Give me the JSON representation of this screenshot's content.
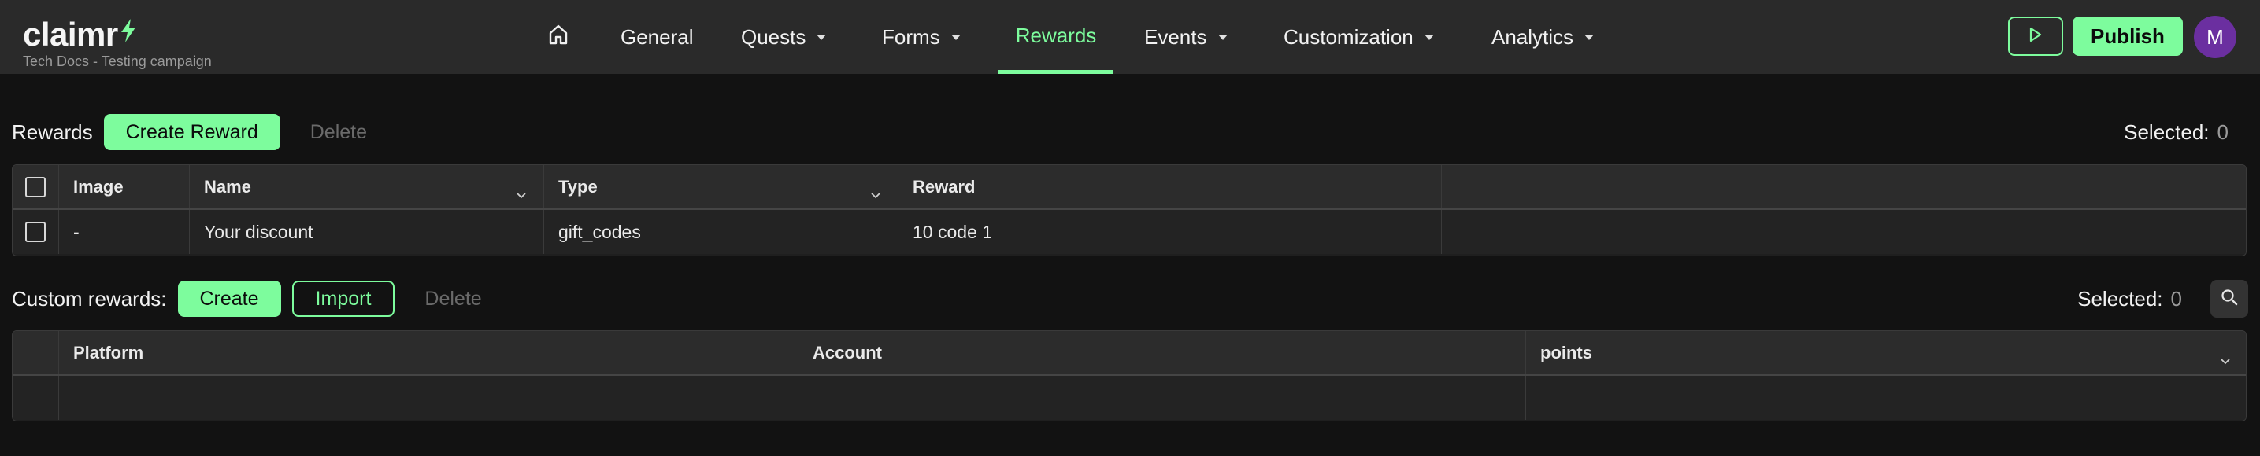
{
  "brand": {
    "name": "claimr",
    "subtitle": "Tech Docs - Testing campaign",
    "accent": "#7dfc9d"
  },
  "nav": {
    "home_icon": "home-icon",
    "items": [
      {
        "label": "General",
        "has_caret": false,
        "active": false
      },
      {
        "label": "Quests",
        "has_caret": true,
        "active": false
      },
      {
        "label": "Forms",
        "has_caret": true,
        "active": false
      },
      {
        "label": "Rewards",
        "has_caret": false,
        "active": true
      },
      {
        "label": "Events",
        "has_caret": true,
        "active": false
      },
      {
        "label": "Customization",
        "has_caret": true,
        "active": false
      },
      {
        "label": "Analytics",
        "has_caret": true,
        "active": false
      }
    ]
  },
  "actions": {
    "preview_icon": "play-icon",
    "publish_label": "Publish",
    "avatar_initial": "M"
  },
  "rewards": {
    "label": "Rewards",
    "create_label": "Create Reward",
    "delete_label": "Delete",
    "selected_label": "Selected:",
    "selected_count": "0",
    "columns": [
      "Image",
      "Name",
      "Type",
      "Reward"
    ],
    "rows": [
      {
        "image": "-",
        "name": "Your discount",
        "type": "gift_codes",
        "reward": "10 code 1"
      }
    ]
  },
  "custom_rewards": {
    "label": "Custom rewards:",
    "create_label": "Create",
    "import_label": "Import",
    "delete_label": "Delete",
    "selected_label": "Selected:",
    "selected_count": "0",
    "search_icon": "search-icon",
    "columns": [
      "Platform",
      "Account",
      "points"
    ]
  }
}
